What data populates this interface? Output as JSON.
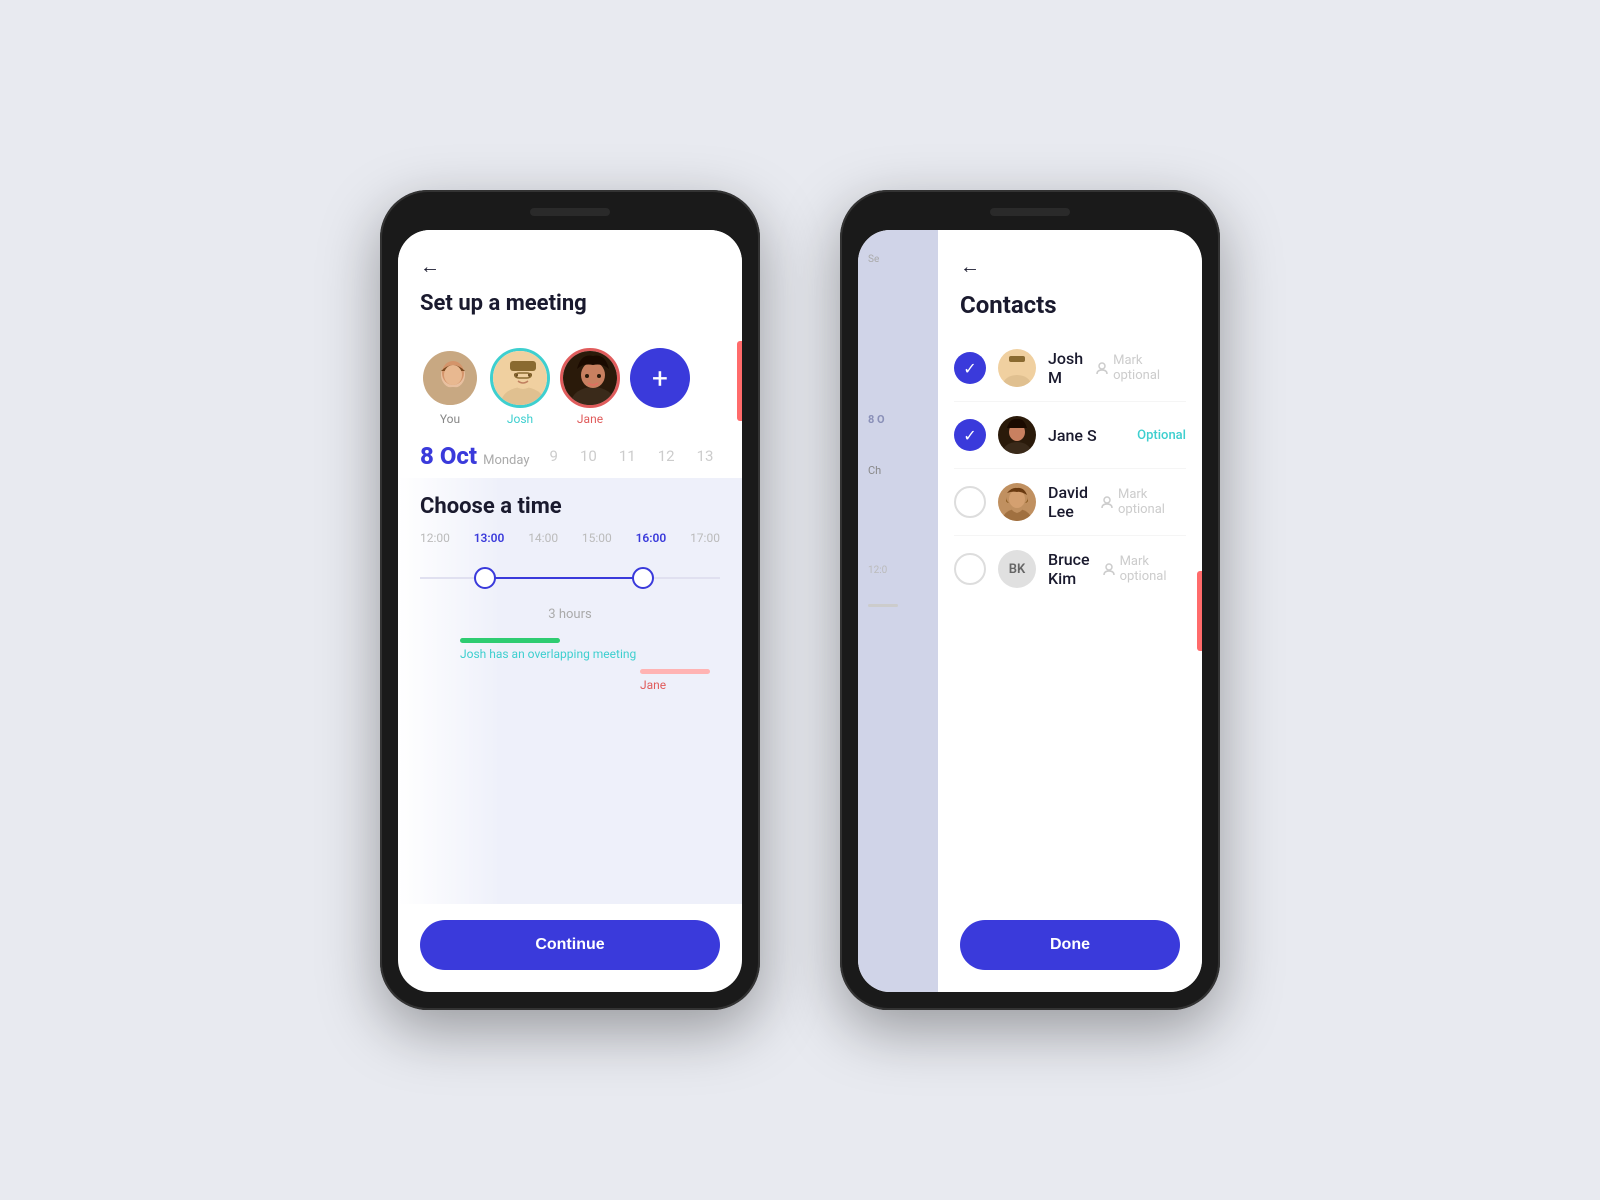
{
  "phone1": {
    "back_arrow": "←",
    "title": "Set up a meeting",
    "avatars": [
      {
        "label": "You",
        "label_style": "default"
      },
      {
        "label": "Josh",
        "label_style": "teal"
      },
      {
        "label": "Jane",
        "label_style": "red"
      }
    ],
    "add_button_label": "+",
    "calendar": {
      "day": "8",
      "month": "Oct",
      "weekday": "Monday",
      "dates": [
        "9",
        "10",
        "11",
        "12",
        "13"
      ]
    },
    "choose_time_label": "Choose a time",
    "time_ruler": [
      "12:00",
      "13:00",
      "14:00",
      "15:00",
      "16:00",
      "17:00"
    ],
    "duration_label": "3 hours",
    "overlap_message": "Josh has an overlapping meeting",
    "jane_label": "Jane",
    "continue_label": "Continue"
  },
  "phone2": {
    "back_arrow": "←",
    "contacts_title": "Contacts",
    "contacts": [
      {
        "name": "Josh M",
        "checked": true,
        "optional_text": "Mark optional"
      },
      {
        "name": "Jane S",
        "checked": true,
        "optional_text": "Optional",
        "is_optional": true
      },
      {
        "name": "David Lee",
        "checked": false,
        "optional_text": "Mark optional",
        "has_photo": true
      },
      {
        "name": "Bruce Kim",
        "checked": false,
        "optional_text": "Mark optional",
        "initials": "BK"
      }
    ],
    "done_label": "Done",
    "bg_label": "Se",
    "bg_cal": "8 O",
    "bg_ch": "Ch",
    "bg_time": "12:0"
  }
}
